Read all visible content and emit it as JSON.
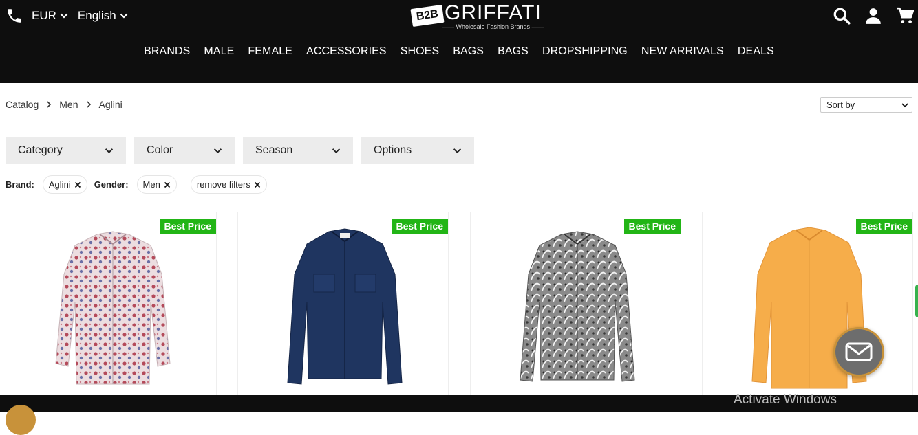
{
  "header": {
    "currency": "EUR",
    "language": "English",
    "logo_badge": "B2B",
    "logo_name": "GRIFFATI",
    "logo_tagline": "—— Wholesale Fashion Brands ——",
    "icons": [
      "phone-icon",
      "search-icon",
      "user-icon",
      "cart-icon"
    ]
  },
  "nav": [
    "BRANDS",
    "MALE",
    "FEMALE",
    "ACCESSORIES",
    "SHOES",
    "BAGS",
    "BAGS",
    "DROPSHIPPING",
    "NEW ARRIVALS",
    "DEALS"
  ],
  "breadcrumb": [
    "Catalog",
    "Men",
    "Aglini"
  ],
  "sort": {
    "label": "Sort by"
  },
  "filters": [
    "Category",
    "Color",
    "Season",
    "Options"
  ],
  "active_filters": {
    "brand_label": "Brand:",
    "brand_value": "Aglini",
    "gender_label": "Gender:",
    "gender_value": "Men",
    "remove_label": "remove filters"
  },
  "products": [
    {
      "badge": "Best Price",
      "color": "#e8d4d8",
      "pattern": "paisley-red"
    },
    {
      "badge": "Best Price",
      "color": "#1f3560",
      "pattern": "denim"
    },
    {
      "badge": "Best Price",
      "color": "#7a7a7a",
      "pattern": "print-gray"
    },
    {
      "badge": "Best Price",
      "color": "#f6ad4a",
      "pattern": "plain-orange"
    }
  ],
  "colors": {
    "header_bg": "#0e0e0e",
    "badge_green": "#22b516",
    "chat_bg": "#6d6d6d",
    "chat_border": "#c8923a"
  },
  "watermark": "Activate Windows"
}
